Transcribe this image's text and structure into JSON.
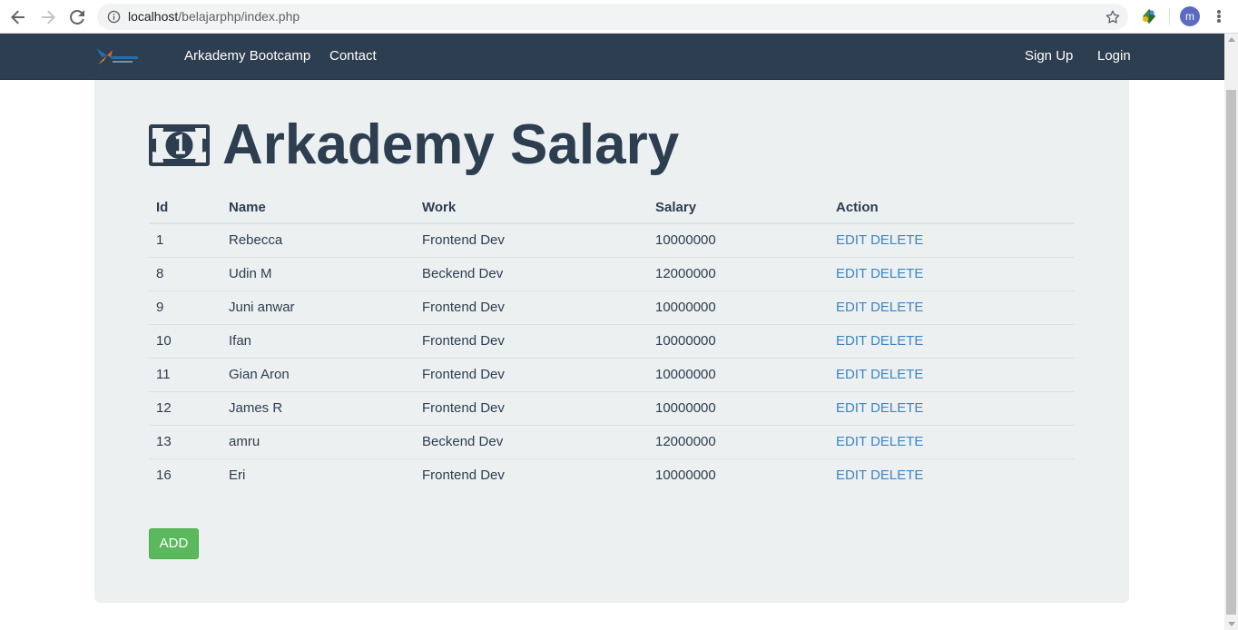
{
  "browser": {
    "url_host": "localhost",
    "url_path": "/belajarphp/index.php",
    "profile_initial": "m"
  },
  "navbar": {
    "brand_icon": "arkademy-logo-icon",
    "links": [
      "Arkademy Bootcamp",
      "Contact"
    ],
    "right_links": [
      "Sign Up",
      "Login"
    ]
  },
  "page": {
    "title": "Arkademy Salary",
    "title_icon": "money-bill-icon"
  },
  "table": {
    "headers": [
      "Id",
      "Name",
      "Work",
      "Salary",
      "Action"
    ],
    "rows": [
      {
        "id": "1",
        "name": "Rebecca",
        "work": "Frontend Dev",
        "salary": "10000000",
        "edit": "EDIT",
        "delete": "DELETE"
      },
      {
        "id": "8",
        "name": "Udin M",
        "work": "Beckend Dev",
        "salary": "12000000",
        "edit": "EDIT",
        "delete": "DELETE"
      },
      {
        "id": "9",
        "name": "Juni anwar",
        "work": "Frontend Dev",
        "salary": "10000000",
        "edit": "EDIT",
        "delete": "DELETE"
      },
      {
        "id": "10",
        "name": "Ifan",
        "work": "Frontend Dev",
        "salary": "10000000",
        "edit": "EDIT",
        "delete": "DELETE"
      },
      {
        "id": "11",
        "name": "Gian Aron",
        "work": "Frontend Dev",
        "salary": "10000000",
        "edit": "EDIT",
        "delete": "DELETE"
      },
      {
        "id": "12",
        "name": "James R",
        "work": "Frontend Dev",
        "salary": "10000000",
        "edit": "EDIT",
        "delete": "DELETE"
      },
      {
        "id": "13",
        "name": "amru",
        "work": "Beckend Dev",
        "salary": "12000000",
        "edit": "EDIT",
        "delete": "DELETE"
      },
      {
        "id": "16",
        "name": "Eri",
        "work": "Frontend Dev",
        "salary": "10000000",
        "edit": "EDIT",
        "delete": "DELETE"
      }
    ]
  },
  "actions": {
    "add_label": "ADD"
  },
  "colors": {
    "navbar_bg": "#2c3e50",
    "jumbotron_bg": "#ecf0f1",
    "link": "#3c85c4",
    "add_button": "#5cb85c"
  }
}
